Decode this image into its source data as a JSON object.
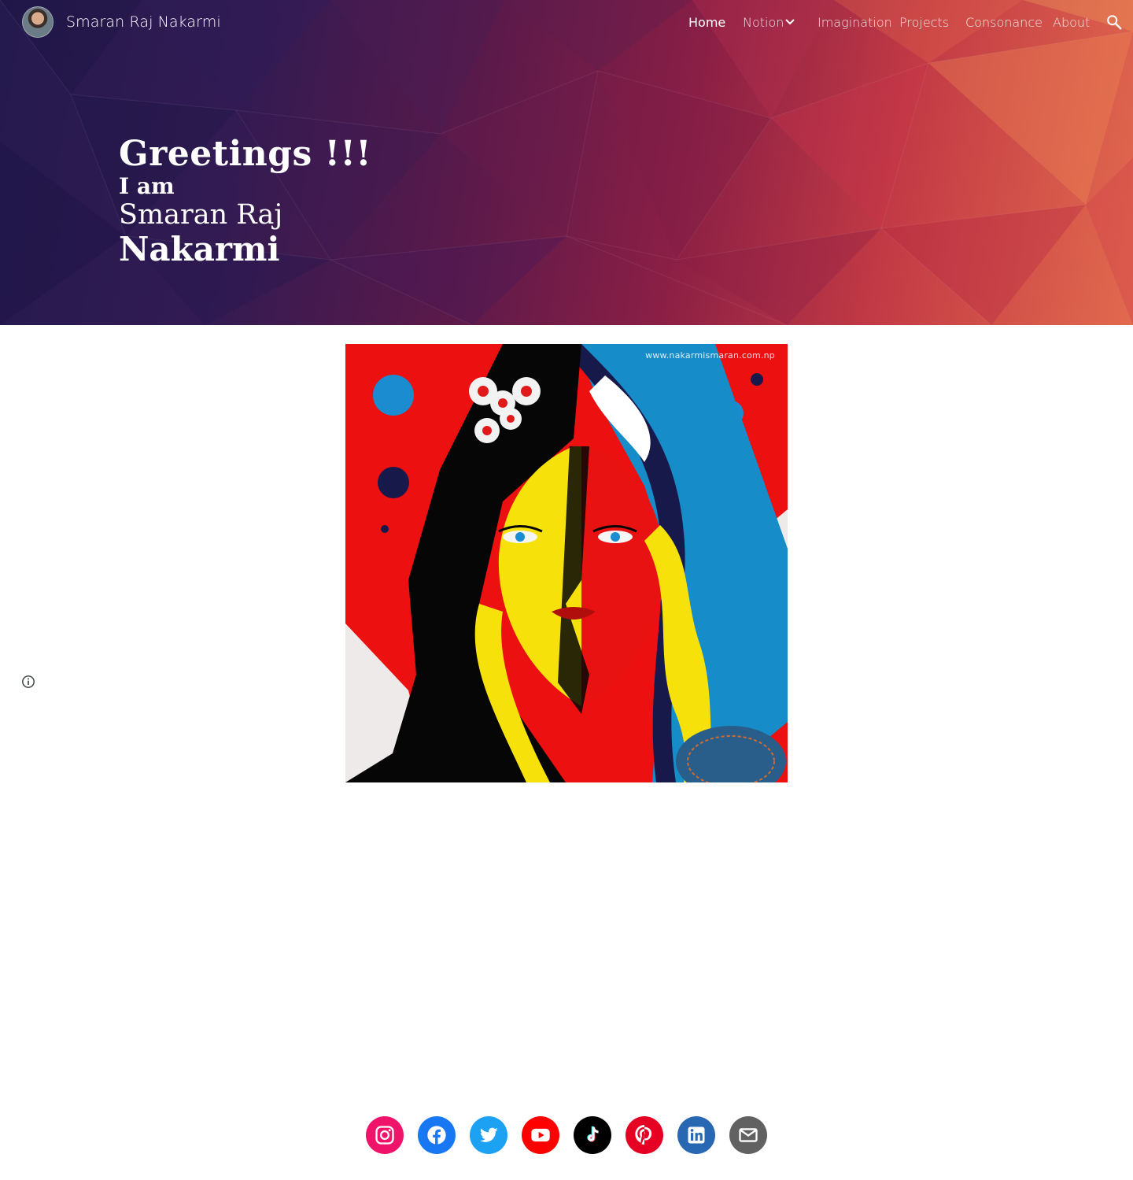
{
  "header": {
    "site_title": "Smaran Raj Nakarmi",
    "nav": [
      {
        "label": "Home",
        "active": true
      },
      {
        "label": "Notion",
        "has_dropdown": true
      },
      {
        "label": "Imagination"
      },
      {
        "label": "Projects"
      },
      {
        "label": "Consonance"
      },
      {
        "label": "About"
      }
    ],
    "search_icon": "search-icon"
  },
  "hero": {
    "line1": "Greetings !!!",
    "line2": "I am",
    "line3": "Smaran Raj",
    "line4": "Nakarmi"
  },
  "artwork": {
    "watermark": "www.nakarmismaran.com.np"
  },
  "social": [
    {
      "name": "instagram",
      "color": "#f0136a"
    },
    {
      "name": "facebook",
      "color": "#1877f2"
    },
    {
      "name": "twitter",
      "color": "#1da1f2"
    },
    {
      "name": "youtube",
      "color": "#ff0000"
    },
    {
      "name": "tiktok",
      "color": "#010101"
    },
    {
      "name": "pinterest",
      "color": "#e60023"
    },
    {
      "name": "linkedin",
      "color": "#2867b2"
    },
    {
      "name": "email",
      "color": "#616161"
    }
  ],
  "colors": {
    "hero_dark": "#241a4e",
    "hero_light": "#e26a4e"
  }
}
